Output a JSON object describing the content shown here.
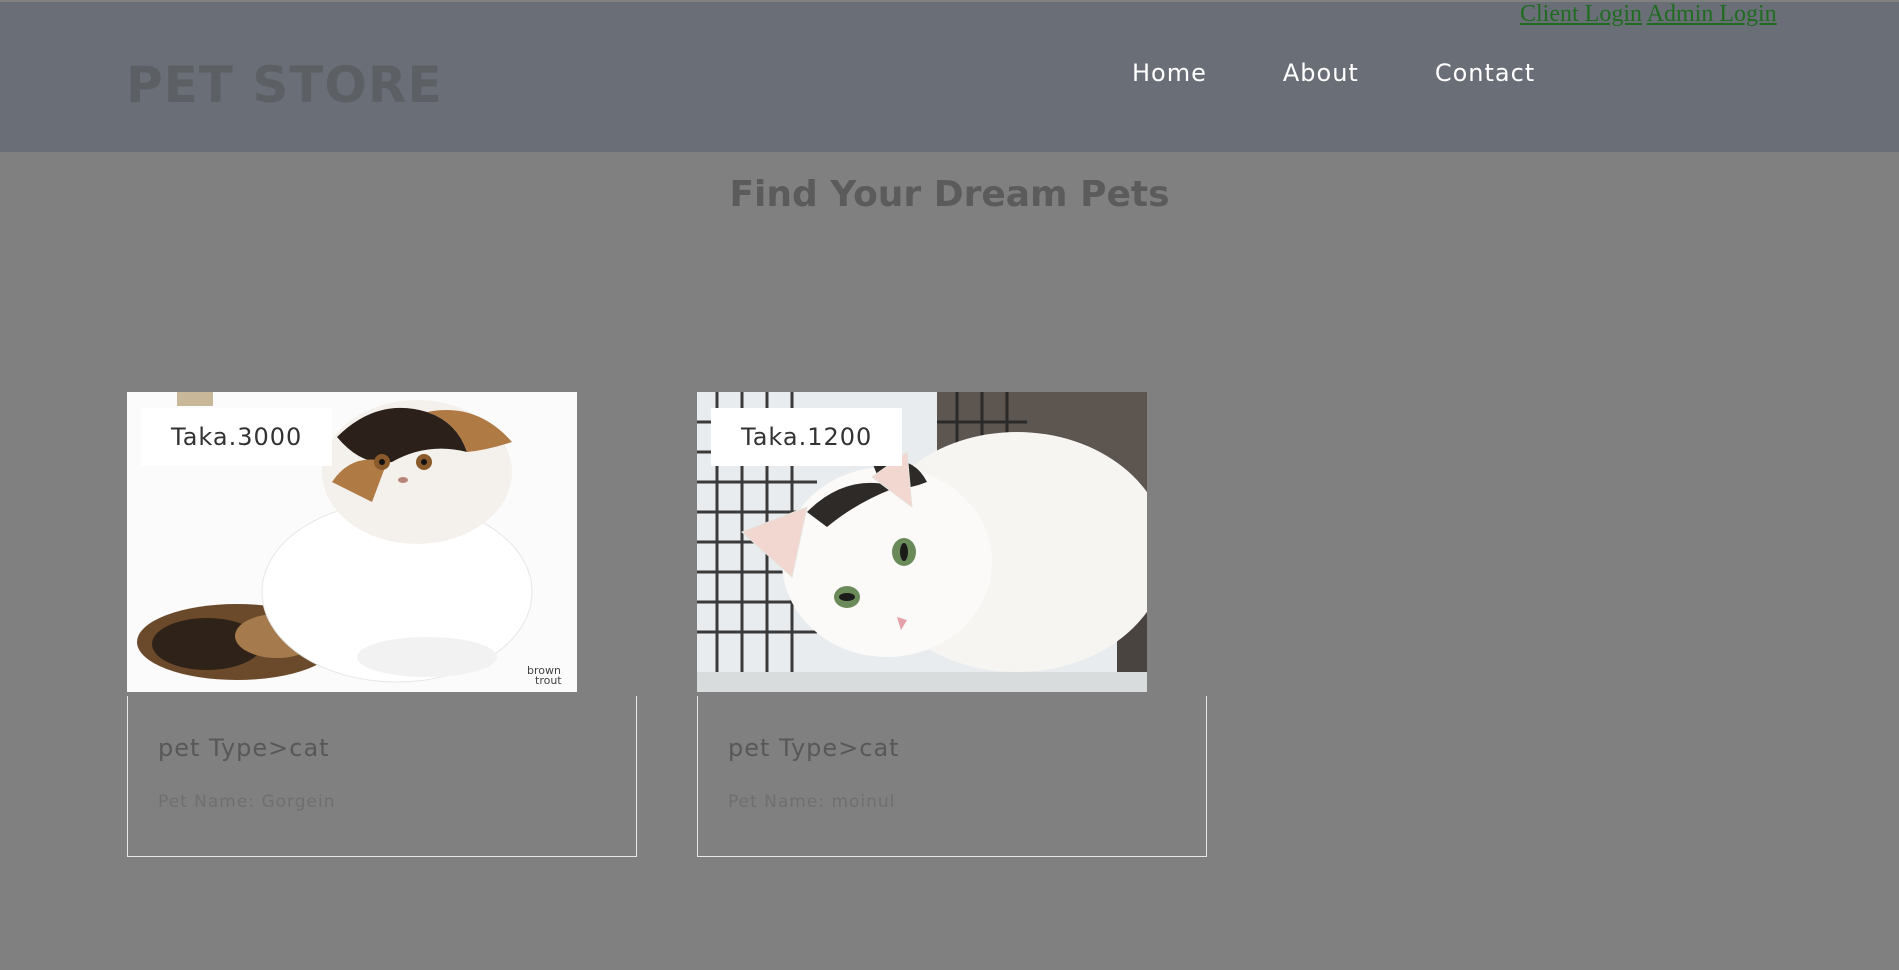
{
  "auth": {
    "client_login": "Client Login",
    "admin_login": "Admin Login"
  },
  "header": {
    "brand": "PET STORE",
    "nav": [
      "Home",
      "About",
      "Contact"
    ]
  },
  "main": {
    "heading": "Find Your Dream Pets"
  },
  "pets": [
    {
      "price": "Taka.3000",
      "type": "pet Type>cat",
      "name": "Pet Name: Gorgein",
      "image": "persian-calico-cat-photo"
    },
    {
      "price": "Taka.1200",
      "type": "pet Type>cat",
      "name": "Pet Name: moinul",
      "image": "white-black-cat-in-cage-photo"
    }
  ],
  "colors": {
    "page_bg": "#808080",
    "header_bg": "#6a6f77",
    "link": "#1f6b1f"
  }
}
